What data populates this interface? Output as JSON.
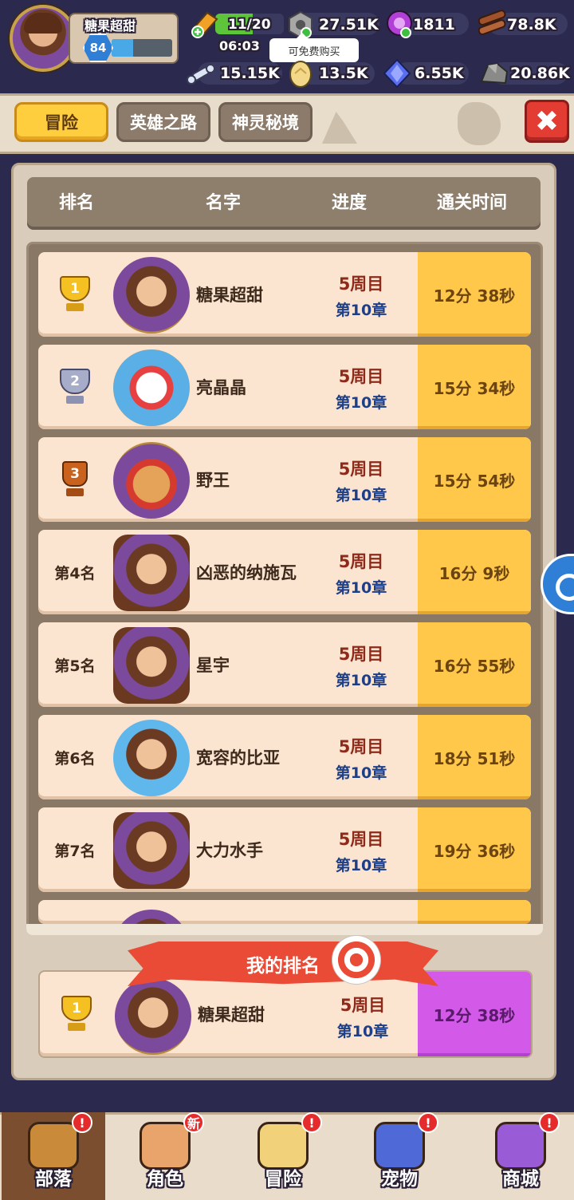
{
  "player": {
    "name": "糖果超甜",
    "level": "84",
    "xp_fraction": 0.35
  },
  "hud": {
    "energy": "11/20",
    "energy_fraction": 0.55,
    "timer": "06:03",
    "tooltip": "可免费购买",
    "resources_row1": [
      {
        "icon": "hex-nut-icon",
        "value": "27.51K"
      },
      {
        "icon": "purple-gem-icon",
        "value": "1811"
      },
      {
        "icon": "wood-logs-icon",
        "value": "78.8K"
      }
    ],
    "resources_row2": [
      {
        "icon": "bone-icon",
        "value": "15.15K"
      },
      {
        "icon": "gold-egg-icon",
        "value": "13.5K"
      },
      {
        "icon": "blue-crystal-icon",
        "value": "6.55K"
      },
      {
        "icon": "stone-icon",
        "value": "20.86K"
      }
    ]
  },
  "tabs": [
    {
      "label": "冒险",
      "active": true
    },
    {
      "label": "英雄之路",
      "active": false
    },
    {
      "label": "神灵秘境",
      "active": false
    }
  ],
  "table": {
    "headers": {
      "rank": "排名",
      "name": "名字",
      "progress": "进度",
      "time": "通关时间"
    },
    "rows": [
      {
        "rank": "1",
        "rank_type": "gold-trophy",
        "avatar": "hero-portrait",
        "name": "糖果超甜",
        "cycle": "5周目",
        "chapter": "第10章",
        "time": "12分 38秒"
      },
      {
        "rank": "2",
        "rank_type": "silver-trophy",
        "avatar": "snowman-portrait",
        "name": "亮晶晶",
        "cycle": "5周目",
        "chapter": "第10章",
        "time": "15分 34秒"
      },
      {
        "rank": "3",
        "rank_type": "bronze-trophy",
        "avatar": "gingerbread-portrait",
        "name": "野王",
        "cycle": "5周目",
        "chapter": "第10章",
        "time": "15分 54秒"
      },
      {
        "rank": "第4名",
        "rank_type": "text",
        "avatar": "tribal-portrait",
        "name": "凶恶的纳施瓦",
        "cycle": "5周目",
        "chapter": "第10章",
        "time": "16分 9秒"
      },
      {
        "rank": "第5名",
        "rank_type": "text",
        "avatar": "tribal-portrait",
        "name": "星宇",
        "cycle": "5周目",
        "chapter": "第10章",
        "time": "16分 55秒"
      },
      {
        "rank": "第6名",
        "rank_type": "text",
        "avatar": "ice-portrait",
        "name": "宽容的比亚",
        "cycle": "5周目",
        "chapter": "第10章",
        "time": "18分 51秒"
      },
      {
        "rank": "第7名",
        "rank_type": "text",
        "avatar": "tribal-portrait",
        "name": "大力水手",
        "cycle": "5周目",
        "chapter": "第10章",
        "time": "19分 36秒"
      }
    ]
  },
  "my_rank": {
    "title": "我的排名",
    "rank": "1",
    "name": "糖果超甜",
    "cycle": "5周目",
    "chapter": "第10章",
    "time": "12分 38秒"
  },
  "nav": [
    {
      "label": "部落",
      "icon": "tribe-hut-icon",
      "active": true,
      "badge": "!"
    },
    {
      "label": "角色",
      "icon": "character-icon",
      "active": false,
      "badge": "新"
    },
    {
      "label": "冒险",
      "icon": "adventure-map-icon",
      "active": false,
      "badge": "!"
    },
    {
      "label": "宠物",
      "icon": "pet-icon",
      "active": false,
      "badge": "!"
    },
    {
      "label": "商城",
      "icon": "shop-icon",
      "active": false,
      "badge": "!"
    }
  ],
  "colors": {
    "gold": "#ffc84a",
    "my_time": "#d35ae9",
    "tab_active": "#ffce3f",
    "close": "#e23c33"
  }
}
